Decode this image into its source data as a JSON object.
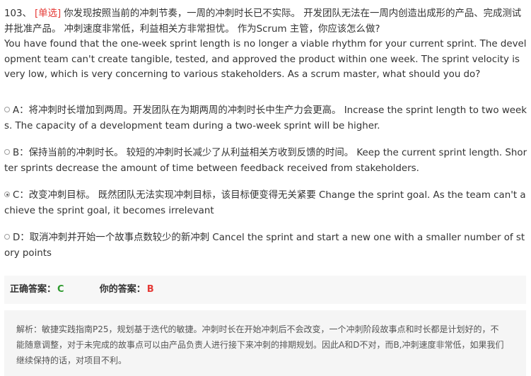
{
  "question": {
    "number": "103、",
    "type": "[单选]",
    "text_cn": "你发现按照当前的冲刺节奏，一周的冲刺时长已不实际。 开发团队无法在一周内创造出成形的产品、完成测试并批准产品。 冲刺速度非常低，利益相关方非常担忧。 作为Scrum 主管，你应该怎么做?",
    "text_en": "You have found that the one-week sprint length is no longer a viable rhythm for your current sprint. The development team can't create tangible, tested, and approved the product within one week. The sprint velocity is very low, which is very concerning to various stakeholders. As a scrum master, what should you do?"
  },
  "options": [
    {
      "text": "A：将冲刺时长增加到两周。开发团队在为期两周的冲刺时长中生产力会更高。 Increase the sprint length to two weeks. The capacity of a development team during a two-week sprint will be higher.",
      "selected": false
    },
    {
      "text": "B：保持当前的冲刺时长。 较短的冲刺时长减少了从利益相关方收到反馈的时间。 Keep the current sprint length. Shorter sprints decrease the amount of time between feedback received from stakeholders.",
      "selected": false
    },
    {
      "text": "C：改变冲刺目标。 既然团队无法实现冲刺目标，该目标便变得无关紧要 Change the sprint goal. As the team can't achieve the sprint goal, it becomes irrelevant",
      "selected": true
    },
    {
      "text": "D：取消冲刺并开始一个故事点数较少的新冲刺 Cancel the sprint and start a new one with a smaller number of story points",
      "selected": false
    }
  ],
  "answers": {
    "correct_label": "正确答案：",
    "correct_value": "C",
    "user_label": "你的答案：",
    "user_value": "B"
  },
  "analysis": {
    "text": "解析：敏捷实践指南P25，规划基于迭代的敏捷。冲刺时长在开始冲刺后不会改变，一个冲刺阶段故事点和时长都是计划好的，不能随意调整，对于未完成的故事点可以由产品负责人进行接下来冲刺的排期规划。因此A和D不对，而B,冲刺速度非常低，如果我们继续保持的话，对项目不利。"
  },
  "colors": {
    "type_tag": "#e53935",
    "correct": "#2e9a2e",
    "wrong": "#e53935",
    "panel_bg": "#f5f5f5"
  }
}
